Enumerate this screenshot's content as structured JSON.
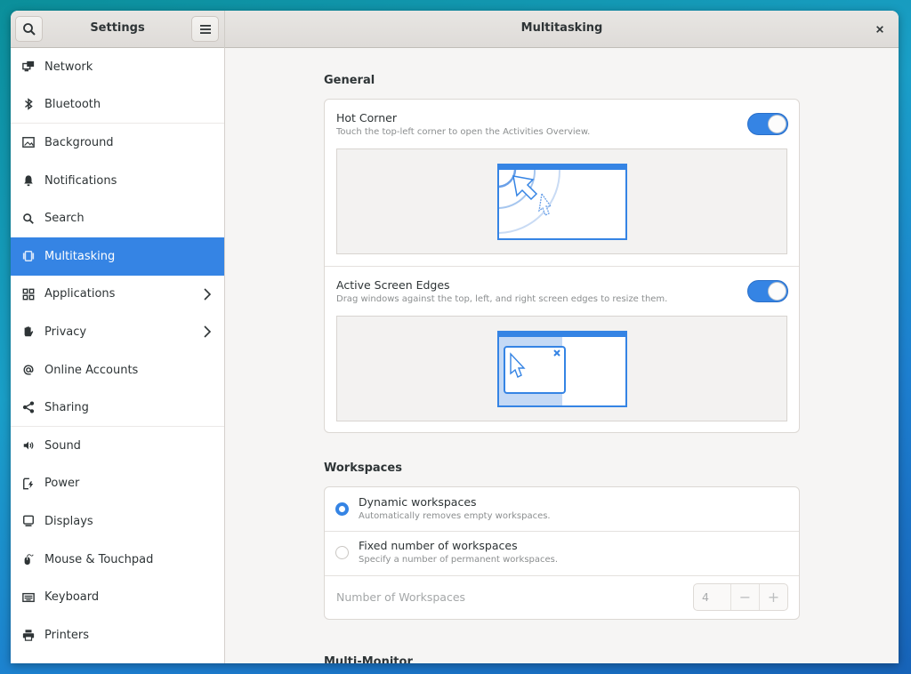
{
  "header": {
    "sidebar_title": "Settings",
    "main_title": "Multitasking",
    "search_icon": "search-icon",
    "menu_icon": "hamburger-menu-icon",
    "close_icon": "close-icon"
  },
  "sidebar": {
    "items": [
      {
        "label": "Network",
        "icon": "network-icon",
        "active": false,
        "chevron": false
      },
      {
        "label": "Bluetooth",
        "icon": "bluetooth-icon",
        "active": false,
        "chevron": false
      },
      {
        "label": "Background",
        "icon": "background-icon",
        "active": false,
        "chevron": false
      },
      {
        "label": "Notifications",
        "icon": "bell-icon",
        "active": false,
        "chevron": false
      },
      {
        "label": "Search",
        "icon": "search-icon",
        "active": false,
        "chevron": false
      },
      {
        "label": "Multitasking",
        "icon": "multitasking-icon",
        "active": true,
        "chevron": false
      },
      {
        "label": "Applications",
        "icon": "applications-grid-icon",
        "active": false,
        "chevron": true
      },
      {
        "label": "Privacy",
        "icon": "hand-icon",
        "active": false,
        "chevron": true
      },
      {
        "label": "Online Accounts",
        "icon": "at-icon",
        "active": false,
        "chevron": false
      },
      {
        "label": "Sharing",
        "icon": "share-icon",
        "active": false,
        "chevron": false
      },
      {
        "label": "Sound",
        "icon": "speaker-icon",
        "active": false,
        "chevron": false
      },
      {
        "label": "Power",
        "icon": "power-icon",
        "active": false,
        "chevron": false
      },
      {
        "label": "Displays",
        "icon": "display-icon",
        "active": false,
        "chevron": false
      },
      {
        "label": "Mouse & Touchpad",
        "icon": "mouse-icon",
        "active": false,
        "chevron": false
      },
      {
        "label": "Keyboard",
        "icon": "keyboard-icon",
        "active": false,
        "chevron": false
      },
      {
        "label": "Printers",
        "icon": "printer-icon",
        "active": false,
        "chevron": false
      }
    ]
  },
  "general": {
    "title": "General",
    "hot_corner": {
      "title": "Hot Corner",
      "subtitle": "Touch the top-left corner to open the Activities Overview.",
      "enabled": true
    },
    "active_edges": {
      "title": "Active Screen Edges",
      "subtitle": "Drag windows against the top, left, and right screen edges to resize them.",
      "enabled": true
    }
  },
  "workspaces": {
    "title": "Workspaces",
    "dynamic": {
      "title": "Dynamic workspaces",
      "subtitle": "Automatically removes empty workspaces.",
      "selected": true
    },
    "fixed": {
      "title": "Fixed number of workspaces",
      "subtitle": "Specify a number of permanent workspaces.",
      "selected": false
    },
    "number": {
      "label": "Number of Workspaces",
      "value": "4",
      "decrement": "−",
      "increment": "+"
    }
  },
  "multi_monitor": {
    "title": "Multi-Monitor"
  },
  "colors": {
    "accent": "#3584e4",
    "sidebar_bg": "#ffffff",
    "content_bg": "#f6f5f4"
  }
}
